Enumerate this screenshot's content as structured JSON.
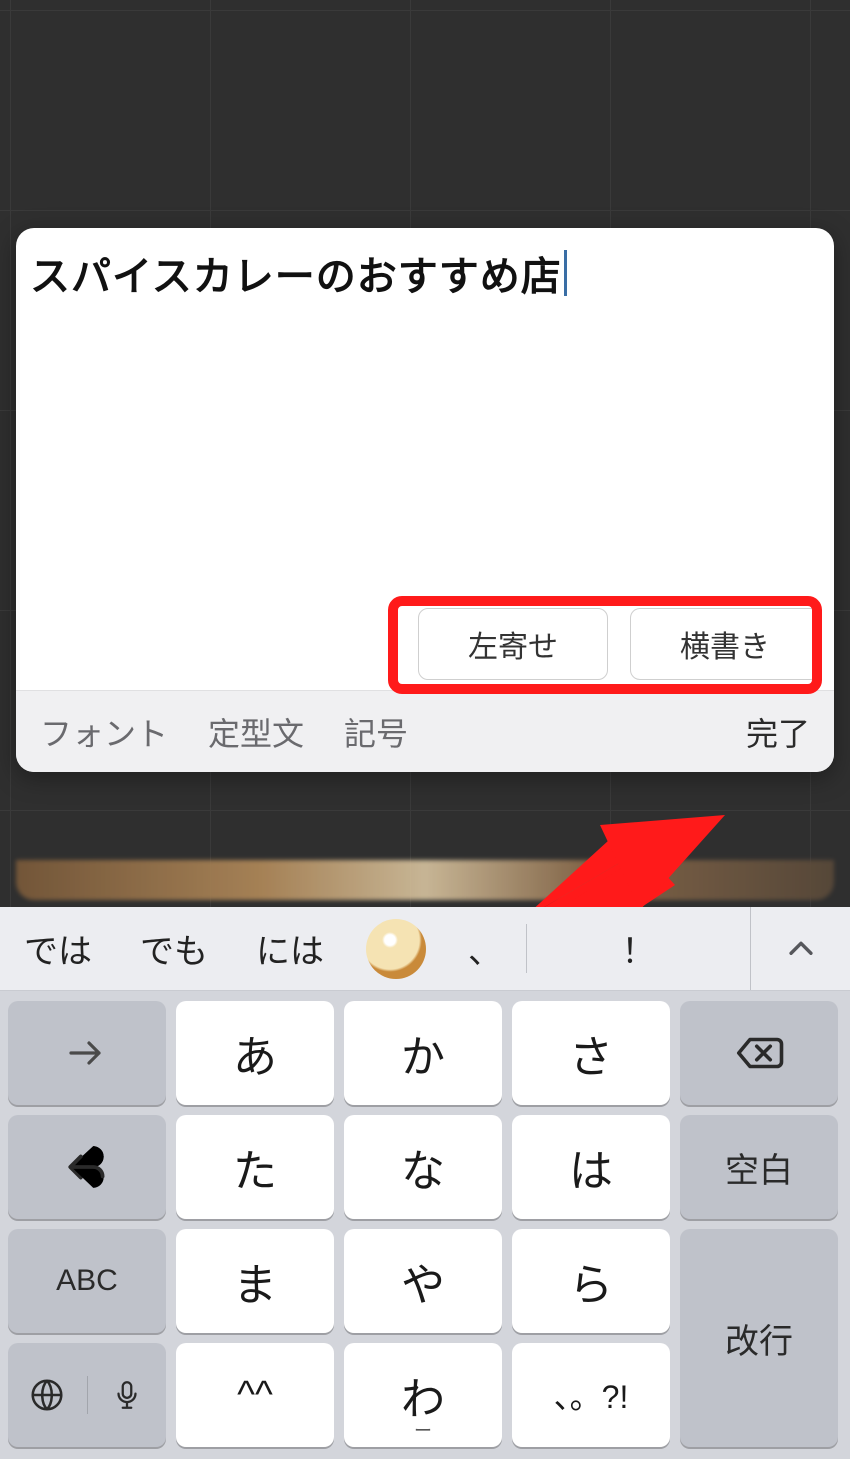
{
  "editor": {
    "text": "スパイスカレーのおすすめ店",
    "align_button": "左寄せ",
    "direction_button": "横書き"
  },
  "toolbar": {
    "font": "フォント",
    "template": "定型文",
    "symbol": "記号",
    "done": "完了"
  },
  "suggestions": {
    "items": [
      "では",
      "でも",
      "には",
      "、",
      "！"
    ],
    "emoji_name": "curry-emoji"
  },
  "keyboard": {
    "rows": [
      {
        "left": {
          "type": "fn",
          "icon": "arrow-right"
        },
        "mid": [
          "あ",
          "か",
          "さ"
        ],
        "right": {
          "type": "fn",
          "icon": "backspace"
        }
      },
      {
        "left": {
          "type": "fn",
          "icon": "undo"
        },
        "mid": [
          "た",
          "な",
          "は"
        ],
        "right": {
          "type": "fn",
          "label": "空白"
        }
      },
      {
        "left": {
          "type": "fn",
          "label": "ABC"
        },
        "mid": [
          "ま",
          "や",
          "ら"
        ],
        "right": {
          "type": "fn",
          "label": "改行",
          "tall": true
        }
      },
      {
        "left": {
          "type": "fn-split",
          "icons": [
            "globe",
            "mic"
          ]
        },
        "mid": [
          "^^",
          "わ",
          "、。?!"
        ],
        "midSub": [
          "",
          "ー",
          ""
        ]
      }
    ],
    "kaomoji": "^^",
    "punct": "、。?!"
  }
}
